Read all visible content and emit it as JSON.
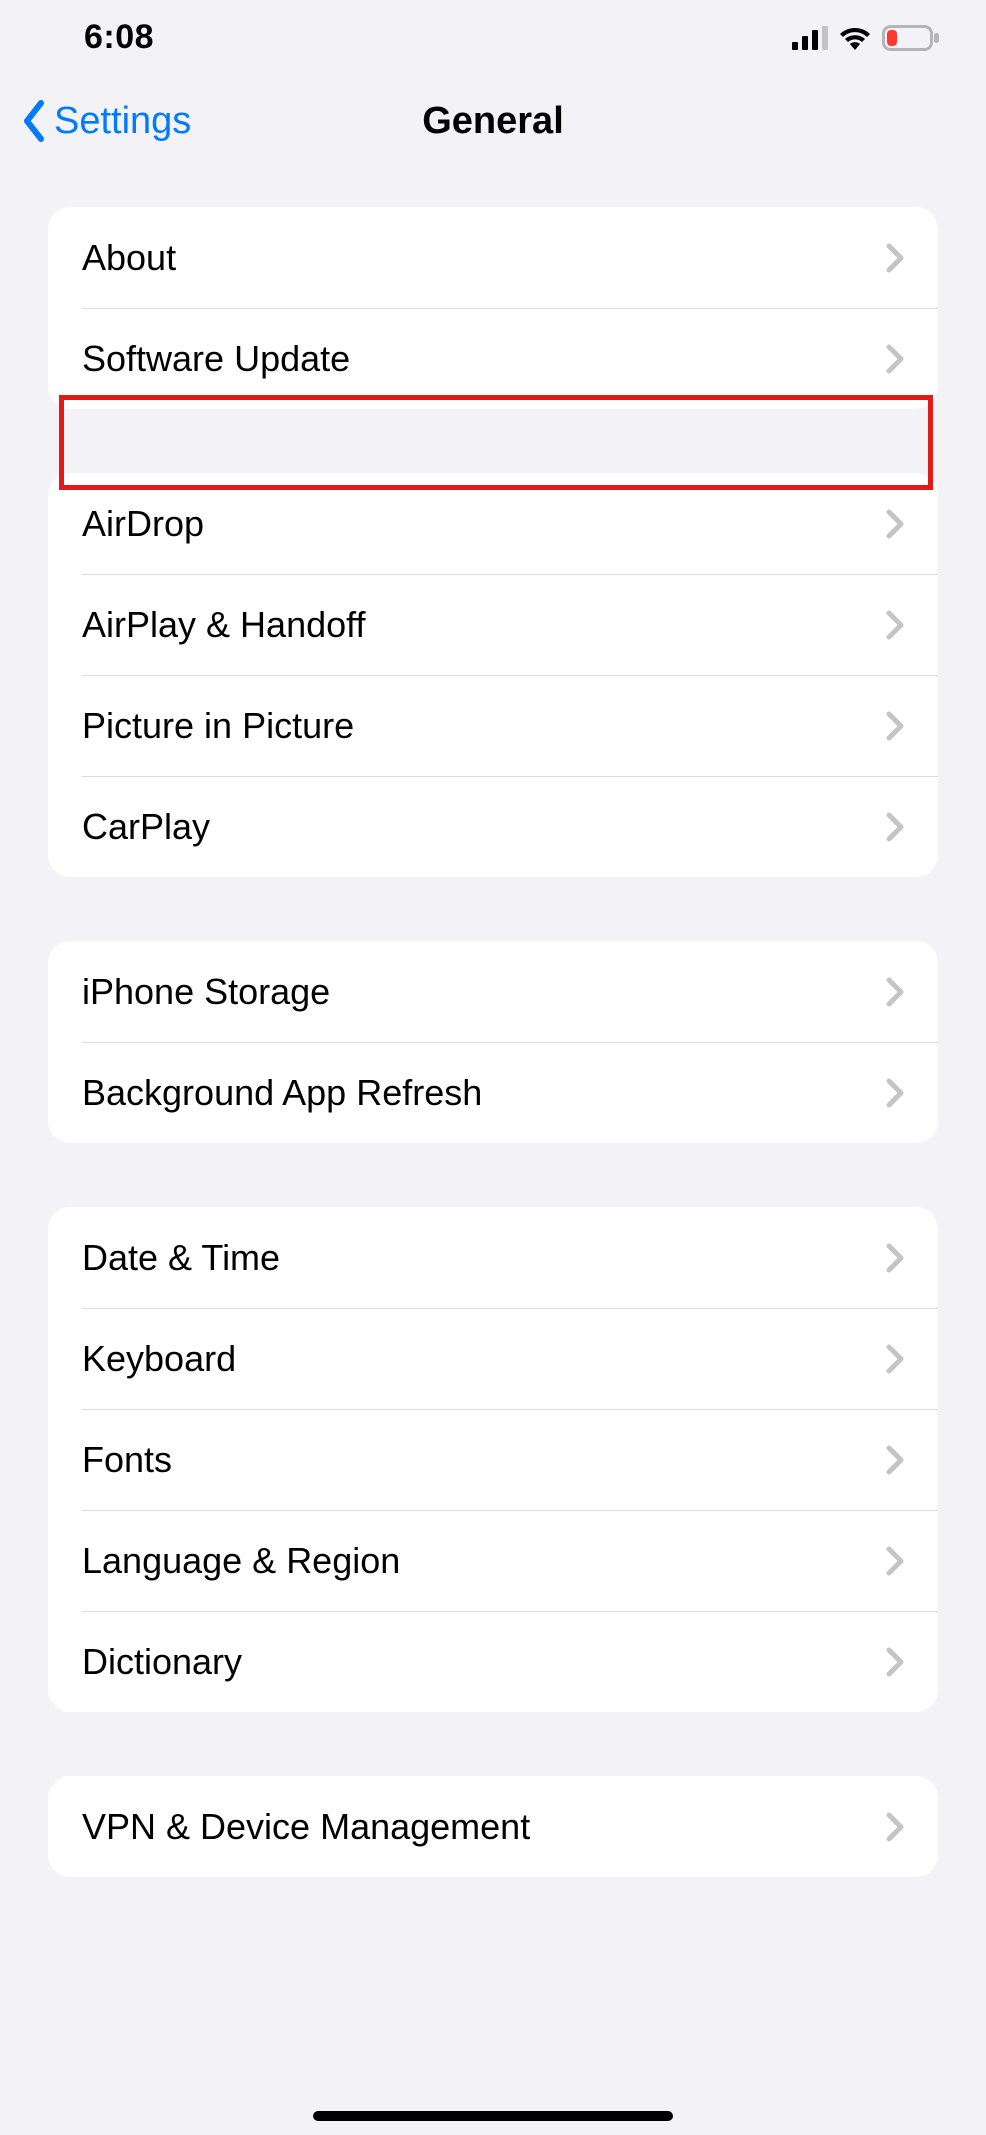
{
  "status_bar": {
    "time": "6:08"
  },
  "nav": {
    "back_label": "Settings",
    "title": "General"
  },
  "groups": [
    {
      "items": [
        {
          "label": "About",
          "highlighted": false
        },
        {
          "label": "Software Update",
          "highlighted": true
        }
      ]
    },
    {
      "items": [
        {
          "label": "AirDrop"
        },
        {
          "label": "AirPlay & Handoff"
        },
        {
          "label": "Picture in Picture"
        },
        {
          "label": "CarPlay"
        }
      ]
    },
    {
      "items": [
        {
          "label": "iPhone Storage"
        },
        {
          "label": "Background App Refresh"
        }
      ]
    },
    {
      "items": [
        {
          "label": "Date & Time"
        },
        {
          "label": "Keyboard"
        },
        {
          "label": "Fonts"
        },
        {
          "label": "Language & Region"
        },
        {
          "label": "Dictionary"
        }
      ]
    },
    {
      "items": [
        {
          "label": "VPN & Device Management"
        }
      ]
    }
  ],
  "colors": {
    "accent": "#007aff",
    "highlight_box": "#e11a1a",
    "battery_low": "#ff3830"
  }
}
